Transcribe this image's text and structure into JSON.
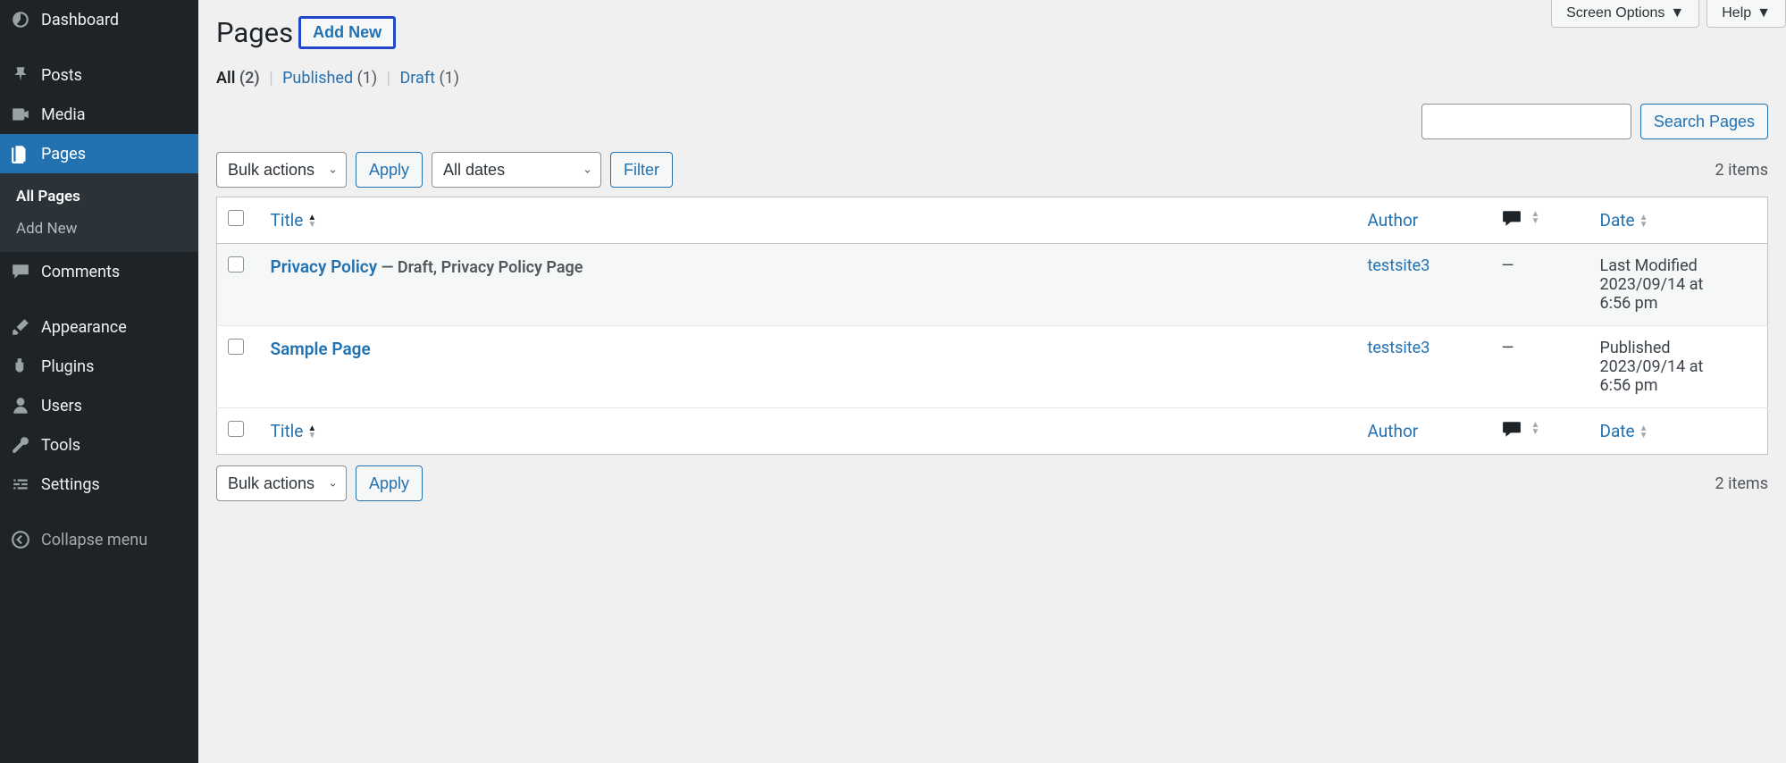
{
  "topControls": {
    "screenOptions": "Screen Options",
    "help": "Help"
  },
  "sidebar": {
    "items": [
      {
        "label": "Dashboard",
        "key": "dashboard"
      },
      {
        "label": "Posts",
        "key": "posts"
      },
      {
        "label": "Media",
        "key": "media"
      },
      {
        "label": "Pages",
        "key": "pages"
      },
      {
        "label": "Comments",
        "key": "comments"
      },
      {
        "label": "Appearance",
        "key": "appearance"
      },
      {
        "label": "Plugins",
        "key": "plugins"
      },
      {
        "label": "Users",
        "key": "users"
      },
      {
        "label": "Tools",
        "key": "tools"
      },
      {
        "label": "Settings",
        "key": "settings"
      }
    ],
    "submenu": [
      {
        "label": "All Pages"
      },
      {
        "label": "Add New"
      }
    ],
    "collapse": "Collapse menu"
  },
  "heading": "Pages",
  "addNew": "Add New",
  "filters": {
    "all": "All",
    "allCount": "(2)",
    "published": "Published",
    "publishedCount": "(1)",
    "draft": "Draft",
    "draftCount": "(1)"
  },
  "bulkActions": "Bulk actions",
  "apply": "Apply",
  "allDates": "All dates",
  "filterBtn": "Filter",
  "searchBtn": "Search Pages",
  "itemsCount": "2 items",
  "columns": {
    "title": "Title",
    "author": "Author",
    "date": "Date"
  },
  "rows": [
    {
      "title": "Privacy Policy",
      "suffix": " — Draft, Privacy Policy Page",
      "author": "testsite3",
      "comments": "—",
      "dateLine1": "Last Modified",
      "dateLine2": "2023/09/14 at",
      "dateLine3": "6:56 pm"
    },
    {
      "title": "Sample Page",
      "suffix": "",
      "author": "testsite3",
      "comments": "—",
      "dateLine1": "Published",
      "dateLine2": "2023/09/14 at",
      "dateLine3": "6:56 pm"
    }
  ]
}
